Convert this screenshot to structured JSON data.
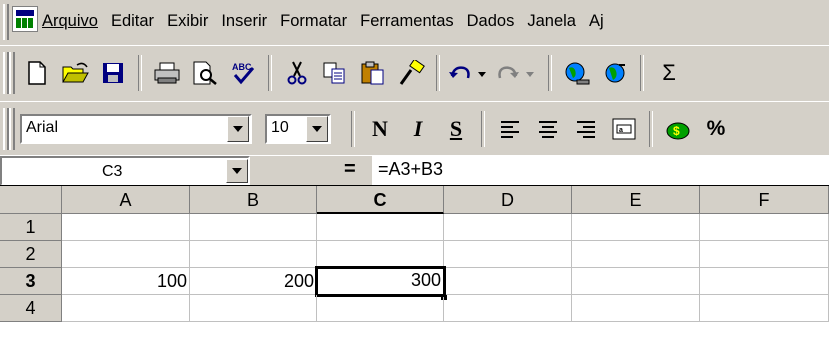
{
  "menubar": {
    "items": [
      {
        "label": "Arquivo",
        "name": "menu-arquivo"
      },
      {
        "label": "Editar",
        "name": "menu-editar"
      },
      {
        "label": "Exibir",
        "name": "menu-exibir"
      },
      {
        "label": "Inserir",
        "name": "menu-inserir"
      },
      {
        "label": "Formatar",
        "name": "menu-formatar"
      },
      {
        "label": "Ferramentas",
        "name": "menu-ferramentas"
      },
      {
        "label": "Dados",
        "name": "menu-dados"
      },
      {
        "label": "Janela",
        "name": "menu-janela"
      },
      {
        "label": "Aj",
        "name": "menu-ajuda"
      }
    ]
  },
  "standard_toolbar": {
    "buttons": [
      "new-icon",
      "open-icon",
      "save-icon",
      "print-icon",
      "print-preview-icon",
      "spelling-icon",
      "cut-icon",
      "copy-icon",
      "paste-icon",
      "format-painter-icon",
      "undo-icon",
      "redo-icon",
      "web-icon",
      "hyperlink-icon",
      "autosum-icon"
    ],
    "autosum_symbol": "Σ"
  },
  "format_toolbar": {
    "font": "Arial",
    "size": "10",
    "bold": "N",
    "italic": "I",
    "underline": "S",
    "currency_symbol": "%",
    "icons": [
      "align-left-icon",
      "align-center-icon",
      "align-right-icon",
      "merge-center-icon",
      "currency-icon",
      "percent-icon"
    ]
  },
  "formula_bar": {
    "name_box": "C3",
    "equals": "=",
    "formula": "=A3+B3"
  },
  "sheet": {
    "columns": [
      "A",
      "B",
      "C",
      "D",
      "E",
      "F"
    ],
    "rows": [
      "1",
      "2",
      "3",
      "4"
    ],
    "active_cell": "C3",
    "cells": {
      "A3": "100",
      "B3": "200",
      "C3": "300"
    }
  }
}
